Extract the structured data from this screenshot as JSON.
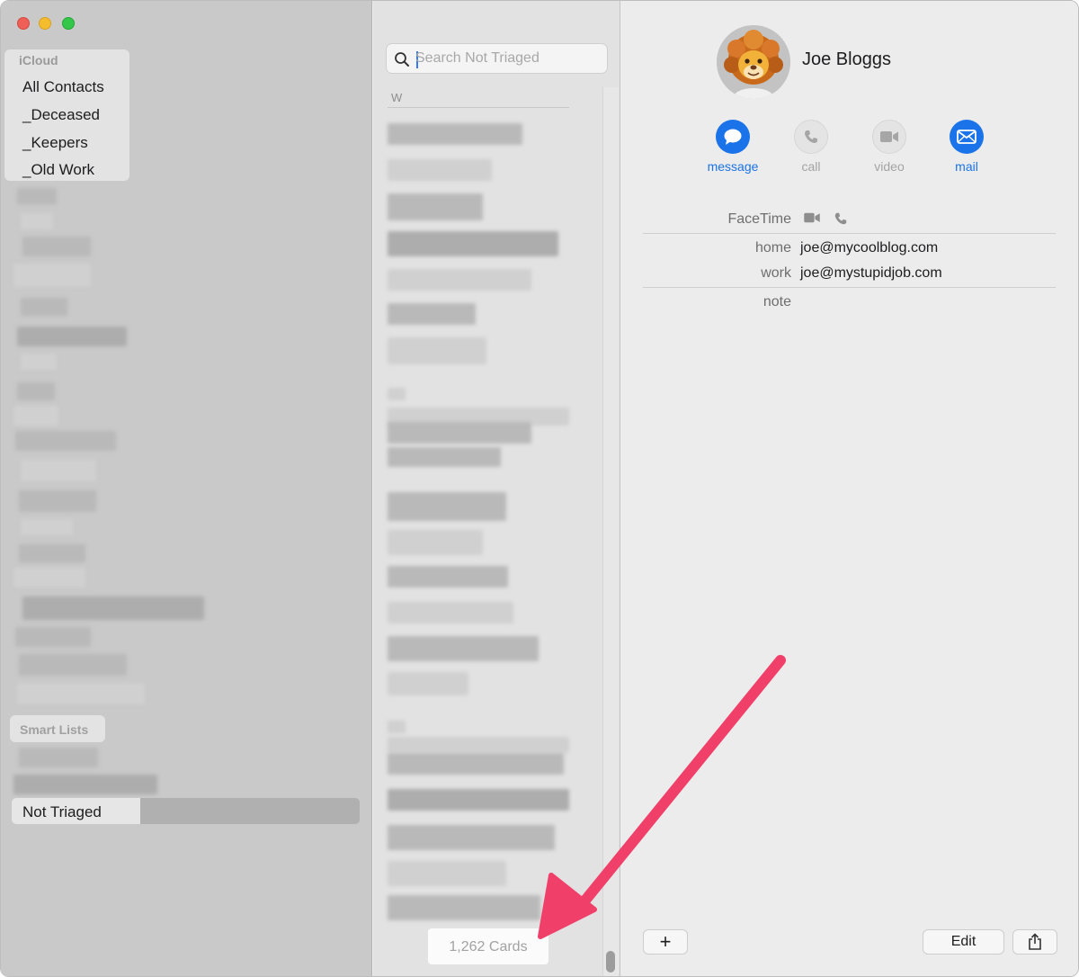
{
  "sidebar": {
    "groups_header": "iCloud",
    "groups": [
      {
        "label": "All Contacts"
      },
      {
        "label": "_Deceased"
      },
      {
        "label": "_Keepers"
      },
      {
        "label": "_Old Work"
      }
    ],
    "smart_lists_header": "Smart Lists",
    "selected_smart_list": "Not Triaged"
  },
  "list": {
    "search_placeholder": "Search Not Triaged",
    "section_letter": "W",
    "card_count": "1,262 Cards"
  },
  "contact": {
    "name": "Joe Bloggs",
    "avatar": "lion-memoji",
    "actions": [
      {
        "label": "message",
        "icon": "message-bubble-icon",
        "enabled": true
      },
      {
        "label": "call",
        "icon": "phone-icon",
        "enabled": false
      },
      {
        "label": "video",
        "icon": "video-camera-icon",
        "enabled": false
      },
      {
        "label": "mail",
        "icon": "envelope-icon",
        "enabled": true
      }
    ],
    "facetime_label": "FaceTime",
    "emails": [
      {
        "label": "home",
        "value": "joe@mycoolblog.com"
      },
      {
        "label": "work",
        "value": "joe@mystupidjob.com"
      }
    ],
    "note_label": "note"
  },
  "toolbar": {
    "add_label": "+",
    "edit_label": "Edit",
    "share_icon": "share-icon"
  },
  "colors": {
    "accent": "#1a73e8",
    "annotation_arrow": "#f0406a"
  }
}
